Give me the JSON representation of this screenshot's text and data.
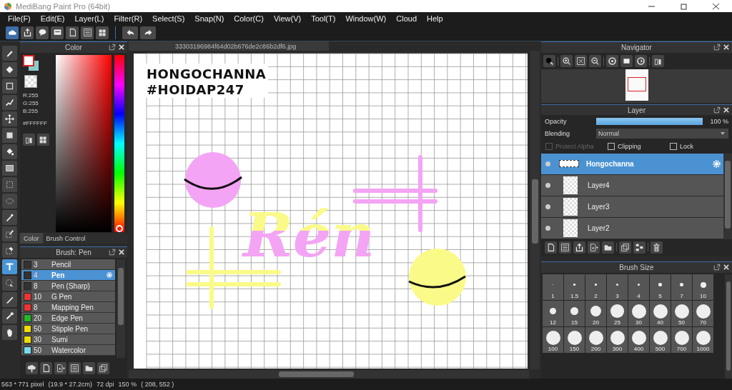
{
  "window": {
    "title": "MediBang Paint Pro (64bit)"
  },
  "menu": [
    "File(F)",
    "Edit(E)",
    "Layer(L)",
    "Filter(R)",
    "Select(S)",
    "Snap(N)",
    "Color(C)",
    "View(V)",
    "Tool(T)",
    "Window(W)",
    "Cloud",
    "Help"
  ],
  "tools": [
    {
      "kind": "brush",
      "selected": false
    },
    {
      "kind": "eraser",
      "selected": false
    },
    {
      "kind": "square",
      "selected": false
    },
    {
      "kind": "polyline",
      "selected": false
    },
    {
      "kind": "move",
      "selected": false
    },
    {
      "kind": "filled",
      "selected": false
    },
    {
      "kind": "bucket",
      "selected": false
    },
    {
      "kind": "gradient",
      "selected": false
    },
    {
      "kind": "select",
      "selected": false
    },
    {
      "kind": "lasso",
      "selected": false
    },
    {
      "kind": "wand",
      "selected": false
    },
    {
      "kind": "selpen",
      "selected": false
    },
    {
      "kind": "seleraser",
      "selected": false
    },
    {
      "kind": "text",
      "selected": true
    },
    {
      "kind": "pointer",
      "selected": false
    },
    {
      "kind": "knife",
      "selected": false
    },
    {
      "kind": "dropper",
      "selected": false
    },
    {
      "kind": "hand",
      "selected": false
    }
  ],
  "color_panel": {
    "title": "Color",
    "hue": {
      "level": 0
    },
    "rgb": [
      "R:255",
      "G:255",
      "B:255"
    ],
    "hex": "#FFFFFF",
    "tabs": [
      {
        "label": "Color",
        "selected": true
      },
      {
        "label": "Brush Control",
        "selected": false
      }
    ]
  },
  "brush_panel": {
    "title": "Brush: Pen",
    "brushes": [
      {
        "size": "3",
        "name": "Pencil",
        "color": "#333333",
        "selected": false
      },
      {
        "size": "4",
        "name": "Pen",
        "color": "#333333",
        "selected": true
      },
      {
        "size": "8",
        "name": "Pen (Sharp)",
        "color": "#333333",
        "selected": false
      },
      {
        "size": "10",
        "name": "G Pen",
        "color": "#ee3333",
        "selected": false
      },
      {
        "size": "8",
        "name": "Mapping Pen",
        "color": "#ee3333",
        "selected": false
      },
      {
        "size": "20",
        "name": "Edge Pen",
        "color": "#22bb22",
        "selected": false
      },
      {
        "size": "50",
        "name": "Stipple Pen",
        "color": "#eedd00",
        "selected": false
      },
      {
        "size": "30",
        "name": "Sumi",
        "color": "#eedd00",
        "selected": false
      },
      {
        "size": "50",
        "name": "Watercolor",
        "color": "#77ddee",
        "selected": false
      }
    ]
  },
  "canvas": {
    "tab": "33303196984f64d02b676de2c86b2df6.jpg",
    "texts": [
      "HONGOCHANNA",
      "#HOIDAP247"
    ],
    "lettering": "Rén"
  },
  "navigator": {
    "title": "Navigator"
  },
  "layer_panel": {
    "title": "Layer",
    "opacity_label": "Opacity",
    "opacity": {
      "level": 1
    },
    "opacity_reading": "100 %",
    "blending_label": "Blending",
    "blending": "Normal",
    "options": [
      {
        "label": "Protect Alpha",
        "checked": false,
        "disabled": true
      },
      {
        "label": "Clipping",
        "checked": false,
        "disabled": false
      },
      {
        "label": "Lock",
        "checked": false,
        "disabled": false
      }
    ],
    "layers": [
      {
        "name": "Hongochanna",
        "selected": true
      },
      {
        "name": "Layer4",
        "selected": false
      },
      {
        "name": "Layer3",
        "selected": false
      },
      {
        "name": "Layer2",
        "selected": false
      }
    ]
  },
  "brush_size": {
    "title": "Brush Size",
    "sizes": [
      "1",
      "1.5",
      "2",
      "3",
      "4",
      "5",
      "7",
      "10",
      "12",
      "15",
      "20",
      "25",
      "30",
      "40",
      "50",
      "70",
      "100",
      "150",
      "200",
      "300",
      "400",
      "500",
      "700",
      "1000"
    ]
  },
  "status_bar": [
    "563 * 771 pixel",
    "(19.9 * 27.2cm)",
    "72 dpi",
    "150 %",
    "( 208, 552 )"
  ]
}
